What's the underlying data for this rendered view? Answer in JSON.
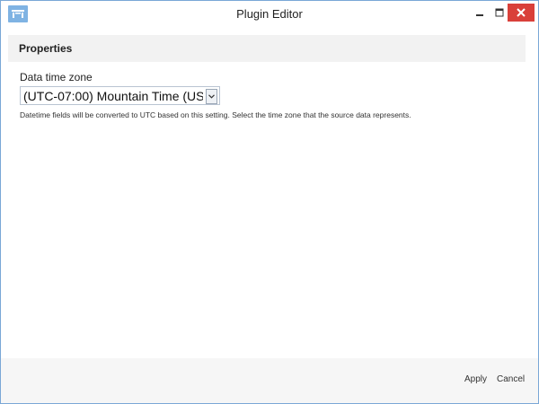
{
  "window": {
    "title": "Plugin Editor"
  },
  "properties": {
    "header": "Properties",
    "time_zone": {
      "label": "Data time zone",
      "selected": "(UTC-07:00) Mountain Time (US...",
      "help": "Datetime fields will be converted to UTC based on this setting. Select the time zone that the source data represents."
    }
  },
  "footer": {
    "apply_label": "Apply",
    "cancel_label": "Cancel"
  },
  "icons": {
    "app": "plugin-editor-icon",
    "minimize": "minimize-icon",
    "maximize": "maximize-icon",
    "close": "close-icon",
    "dropdown": "chevron-down-icon"
  },
  "colors": {
    "close_button": "#d9403a",
    "app_icon": "#7fb3e3",
    "window_border": "#7aa7d6"
  }
}
